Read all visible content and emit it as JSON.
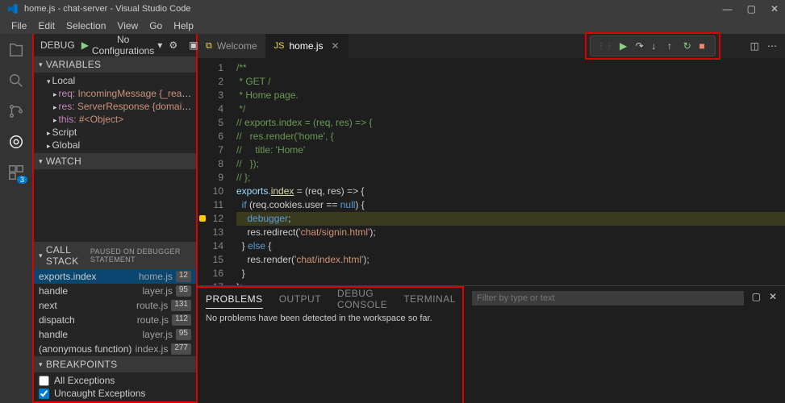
{
  "titlebar": {
    "title": "home.js - chat-server - Visual Studio Code"
  },
  "menu": {
    "file": "File",
    "edit": "Edit",
    "selection": "Selection",
    "view": "View",
    "go": "Go",
    "help": "Help"
  },
  "sidebar": {
    "debug_label": "DEBUG",
    "config_label": "No Configurations",
    "variables_header": "VARIABLES",
    "local_label": "Local",
    "req_label": "req",
    "req_val": ": IncomingMessage {_readableSta…",
    "res_label": "res",
    "res_val": ": ServerResponse {domain: null,…",
    "this_label": "this",
    "this_val": ": #<Object>",
    "script_label": "Script",
    "global_label": "Global",
    "watch_header": "WATCH",
    "callstack_header": "CALL STACK",
    "callstack_status": "PAUSED ON DEBUGGER STATEMENT",
    "cs": [
      {
        "fn": "exports.index",
        "file": "home.js",
        "line": "12"
      },
      {
        "fn": "handle",
        "file": "layer.js",
        "line": "95"
      },
      {
        "fn": "next",
        "file": "route.js",
        "line": "131"
      },
      {
        "fn": "dispatch",
        "file": "route.js",
        "line": "112"
      },
      {
        "fn": "handle",
        "file": "layer.js",
        "line": "95"
      },
      {
        "fn": "(anonymous function)",
        "file": "index.js",
        "line": "277"
      }
    ],
    "breakpoints_header": "BREAKPOINTS",
    "bp_all": "All Exceptions",
    "bp_uncaught": "Uncaught Exceptions"
  },
  "tabs": {
    "welcome": "Welcome",
    "home": "home.js"
  },
  "code": {
    "lines": [
      "/**",
      " * GET /",
      " * Home page.",
      " */",
      "// exports.index = (req, res) => {",
      "//   res.render('home', {",
      "//     title: 'Home'",
      "//   });",
      "// };",
      "",
      "",
      "",
      "",
      "",
      "",
      "",
      ""
    ]
  },
  "code10": {
    "a": "exports.",
    "b": "index",
    "c": " = (req, res) => {"
  },
  "code11": {
    "a": "  ",
    "b": "if",
    "c": " (req.cookies.user == ",
    "d": "null",
    "e": ") {"
  },
  "code12": {
    "a": "    ",
    "b": "debugger",
    "c": ";"
  },
  "code13": {
    "a": "    res.redirect(",
    "b": "'chat/signin.html'",
    "c": ");"
  },
  "code14": {
    "a": "  } ",
    "b": "else",
    "c": " {"
  },
  "code15": {
    "a": "    res.render(",
    "b": "'chat/index.html'",
    "c": ");"
  },
  "code16": "  }",
  "code17": "};",
  "panel": {
    "problems": "PROBLEMS",
    "output": "OUTPUT",
    "debugconsole": "DEBUG CONSOLE",
    "terminal": "TERMINAL",
    "msg": "No problems have been detected in the workspace so far.",
    "filter_placeholder": "Filter by type or text"
  },
  "activitybar": {
    "badge": "3"
  }
}
